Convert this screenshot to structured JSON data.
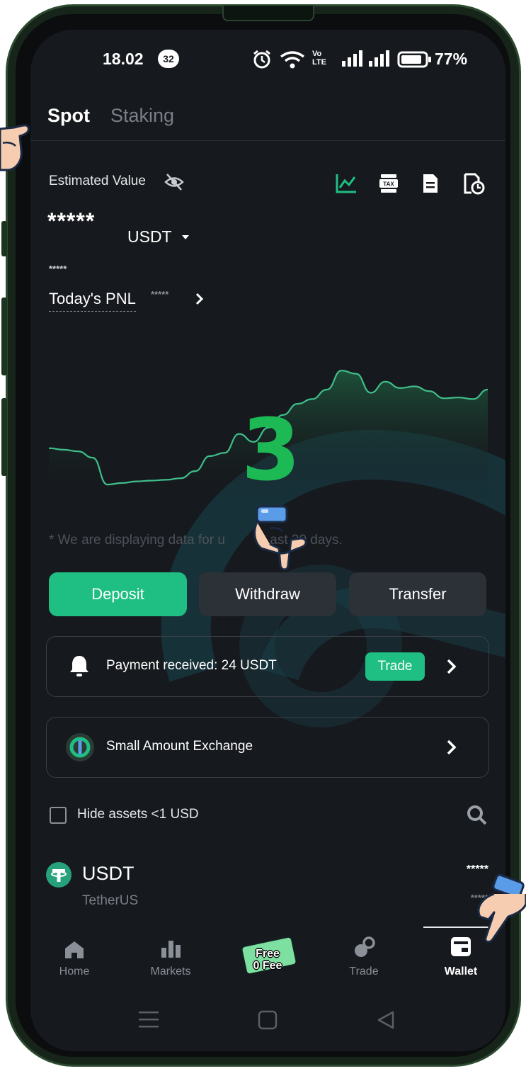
{
  "status_bar": {
    "time": "18.02",
    "notif_count": "32",
    "volte": "Vo\nLTE",
    "battery": "77%"
  },
  "tabs": [
    {
      "label": "Spot",
      "active": true
    },
    {
      "label": "Staking",
      "active": false
    }
  ],
  "estimated": {
    "label": "Estimated Value",
    "value_masked": "*****",
    "currency": "USDT",
    "sub_masked": "*****",
    "pnl_label": "Today's PNL",
    "pnl_masked": "*****"
  },
  "header_icons": [
    "line-chart-icon",
    "tax-icon",
    "document-icon",
    "history-icon"
  ],
  "tax_text": "TAX",
  "chart_data": {
    "type": "area",
    "x": [
      0,
      1,
      2,
      3,
      4,
      5,
      6,
      7,
      8,
      9,
      10,
      11,
      12,
      13,
      14,
      15,
      16,
      17,
      18,
      19,
      20,
      21,
      22,
      23,
      24,
      25,
      26,
      27,
      28,
      29,
      30
    ],
    "y": [
      62,
      60,
      58,
      50,
      16,
      18,
      20,
      21,
      22,
      24,
      33,
      52,
      56,
      80,
      70,
      88,
      104,
      118,
      124,
      136,
      160,
      156,
      132,
      146,
      138,
      140,
      134,
      125,
      126,
      124,
      136
    ],
    "ylim": [
      0,
      170
    ],
    "grid": false,
    "line_color": "#3fbf8a"
  },
  "chart_note": "* We are displaying data for u            ast 30 days.",
  "overlay_step": "3",
  "actions": {
    "deposit": "Deposit",
    "withdraw": "Withdraw",
    "transfer": "Transfer"
  },
  "notice": {
    "text": "Payment received: 24 USDT",
    "trade": "Trade"
  },
  "exchange": {
    "text": "Small Amount Exchange"
  },
  "filter": {
    "hide_label": "Hide assets <1 USD"
  },
  "asset": {
    "symbol": "USDT",
    "name": "TetherUS",
    "amount_masked": "*****",
    "value_masked": "*****"
  },
  "nav": {
    "home": "Home",
    "markets": "Markets",
    "promo": "Free\n0 Fee",
    "trade": "Trade",
    "wallet": "Wallet"
  },
  "colors": {
    "accent": "#1fbf83",
    "background": "#16191d",
    "step_green": "#1db954"
  }
}
